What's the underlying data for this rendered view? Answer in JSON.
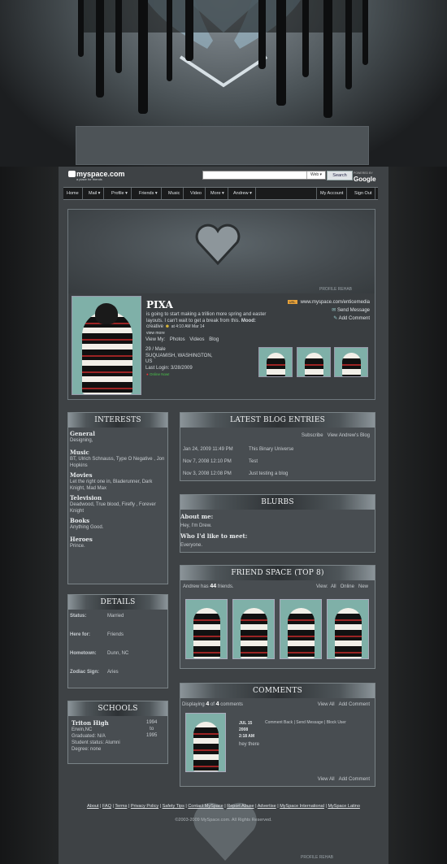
{
  "header": {
    "logo_text": "myspace.com",
    "logo_tagline": "a place for friends",
    "search_scope": "Web ▾",
    "search_button": "Search",
    "powered_by": "POWERED BY",
    "google_text": "Google"
  },
  "nav": {
    "items": [
      "Home",
      "Mail ▾",
      "Profile ▾",
      "Friends ▾",
      "Music",
      "Video",
      "More ▾",
      "Andrew ▾"
    ],
    "right": [
      "My Account",
      "Sign Out"
    ]
  },
  "hero": {
    "credit": "PROFILE REHAB"
  },
  "profile": {
    "name": "PIXA",
    "status_text": "is going to start making a trillion more spring and easter layouts. I can't wait to get a break from this.",
    "mood_label": "Mood:",
    "mood_value": "creative",
    "mood_time": "at 4:10 AM Mar 14",
    "view_more": "view more",
    "view_my_label": "View My:",
    "view_my_links": [
      "Photos",
      "Videos",
      "Blog"
    ],
    "age_sex": "29 / Male",
    "location": "SUQUAMISH, WASHINGTON,",
    "country": "US",
    "last_login": "Last Login: 3/28/2009",
    "online_now": "Online Now!",
    "url_badge": "URL",
    "url": "www.myspace.com/enticemedia",
    "send_message": "Send Message",
    "add_comment": "Add Comment"
  },
  "interests": {
    "title": "INTERESTS",
    "sections": [
      {
        "heading": "General",
        "text": "Designing,"
      },
      {
        "heading": "Music",
        "text": "BT, Ulrich Schnauss, Type O Negative , Jon Hopkins"
      },
      {
        "heading": "Movies",
        "text": "Let the right one in, Bladerunner, Dark Knight, Mad Max"
      },
      {
        "heading": "Television",
        "text": "Deadwood, True blood, Firefly , Forever Knight"
      },
      {
        "heading": "Books",
        "text": "Anything Good."
      },
      {
        "heading": "Heroes",
        "text": "Prince."
      }
    ]
  },
  "details": {
    "title": "DETAILS",
    "rows": [
      {
        "label": "Status:",
        "value": "Married"
      },
      {
        "label": "Here for:",
        "value": "Friends"
      },
      {
        "label": "Hometown:",
        "value": "Dunn, NC"
      },
      {
        "label": "Zodiac Sign:",
        "value": "Aries"
      }
    ]
  },
  "schools": {
    "title": "SCHOOLS",
    "name": "Triton High",
    "city": "Erwin,NC",
    "graduated": "Graduated: N/A",
    "student_status": "Student status: Alumni",
    "degree": "Degree: none",
    "year_start": "1994",
    "year_to": "to",
    "year_end": "1995"
  },
  "blog": {
    "title": "LATEST BLOG ENTRIES",
    "subscribe": "Subscribe",
    "view_blog": "View Andrew's Blog",
    "entries": [
      {
        "date": "Jan 24, 2009 11:49 PM",
        "title": "This Binary Universe"
      },
      {
        "date": "Nov 7, 2008 12:10 PM",
        "title": "Test"
      },
      {
        "date": "Nov 3, 2008 12:08 PM",
        "title": "Just testing a blog"
      }
    ]
  },
  "blurbs": {
    "title": "BLURBS",
    "about_heading": "About me:",
    "about_text": "Hey, I'm Drew.",
    "meet_heading": "Who I'd like to meet:",
    "meet_text": "Everyone."
  },
  "friends": {
    "title": "FRIEND SPACE (TOP 8)",
    "count_prefix": "Andrew has",
    "count": "44",
    "count_suffix": "friends.",
    "view_label": "View:",
    "view_all": "All",
    "view_online": "Online",
    "view_new": "New"
  },
  "comments": {
    "title": "COMMENTS",
    "displaying": "Displaying",
    "shown": "4",
    "of": "of",
    "total": "4",
    "comments_word": "comments",
    "view_all": "View All",
    "add_comment": "Add Comment",
    "date": "JUL 15",
    "year": "2008",
    "time": "2:18 AM",
    "comment_back": "Comment Back",
    "send_message": "Send Message",
    "block_user": "Block User",
    "text": "hey there"
  },
  "footer": {
    "links": [
      "About",
      "FAQ",
      "Terms",
      "Privacy Policy",
      "Safety Tips",
      "Contact MySpace",
      "Report Abuse",
      "Advertise",
      "MySpace International",
      "MySpace Latino"
    ],
    "copyright": "©2003-2009 MySpace.com. All Rights Reserved.",
    "credit": "PROFILE REHAB"
  }
}
